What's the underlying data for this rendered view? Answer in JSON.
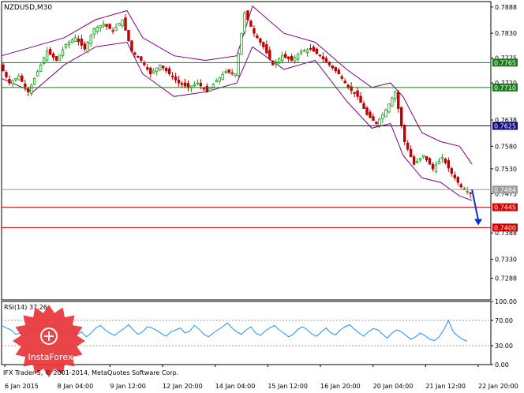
{
  "chart_data": [
    {
      "type": "candlestick",
      "title": "NZDUSD,M30",
      "ylim": [
        0.724,
        0.79
      ],
      "y_tick_labels": [
        "0.7888",
        "0.7830",
        "0.7775",
        "0.7720",
        "0.7638",
        "0.7580",
        "0.7530",
        "0.7475",
        "0.7388",
        "0.7330",
        "0.7288"
      ],
      "y_tick_values": [
        0.7888,
        0.783,
        0.7775,
        0.772,
        0.7638,
        0.758,
        0.753,
        0.7475,
        0.7388,
        0.733,
        0.7288
      ],
      "x_tick_labels": [
        "6 Jan 2015",
        "8 Jan 04:00",
        "9 Jan 12:00",
        "12 Jan 20:00",
        "14 Jan 04:00",
        "15 Jan 12:00",
        "16 Jan 20:00",
        "20 Jan 04:00",
        "21 Jan 12:00",
        "22 Jan 20:00"
      ],
      "close_path": [
        [
          0,
          0.776
        ],
        [
          3,
          0.772
        ],
        [
          6,
          0.7735
        ],
        [
          9,
          0.77
        ],
        [
          12,
          0.7745
        ],
        [
          15,
          0.779
        ],
        [
          18,
          0.777
        ],
        [
          21,
          0.7805
        ],
        [
          24,
          0.782
        ],
        [
          27,
          0.7795
        ],
        [
          30,
          0.784
        ],
        [
          33,
          0.785
        ],
        [
          36,
          0.7835
        ],
        [
          39,
          0.786
        ],
        [
          42,
          0.779
        ],
        [
          45,
          0.777
        ],
        [
          48,
          0.774
        ],
        [
          51,
          0.776
        ],
        [
          54,
          0.774
        ],
        [
          57,
          0.772
        ],
        [
          60,
          0.771
        ],
        [
          63,
          0.772
        ],
        [
          66,
          0.77
        ],
        [
          69,
          0.7725
        ],
        [
          72,
          0.7745
        ],
        [
          75,
          0.774
        ],
        [
          78,
          0.7875
        ],
        [
          81,
          0.783
        ],
        [
          84,
          0.78
        ],
        [
          87,
          0.776
        ],
        [
          90,
          0.778
        ],
        [
          93,
          0.777
        ],
        [
          96,
          0.779
        ],
        [
          99,
          0.7795
        ],
        [
          102,
          0.778
        ],
        [
          105,
          0.776
        ],
        [
          108,
          0.774
        ],
        [
          111,
          0.771
        ],
        [
          114,
          0.769
        ],
        [
          117,
          0.765
        ],
        [
          120,
          0.763
        ],
        [
          123,
          0.766
        ],
        [
          126,
          0.77
        ],
        [
          129,
          0.759
        ],
        [
          132,
          0.754
        ],
        [
          135,
          0.756
        ],
        [
          138,
          0.753
        ],
        [
          141,
          0.7555
        ],
        [
          144,
          0.752
        ],
        [
          147,
          0.749
        ],
        [
          150,
          0.7475
        ]
      ],
      "bands": [
        {
          "name": "upper",
          "values": [
            [
              0,
              0.778
            ],
            [
              10,
              0.78
            ],
            [
              20,
              0.782
            ],
            [
              30,
              0.786
            ],
            [
              40,
              0.788
            ],
            [
              45,
              0.782
            ],
            [
              55,
              0.778
            ],
            [
              65,
              0.777
            ],
            [
              75,
              0.778
            ],
            [
              80,
              0.789
            ],
            [
              90,
              0.783
            ],
            [
              100,
              0.781
            ],
            [
              110,
              0.775
            ],
            [
              118,
              0.771
            ],
            [
              124,
              0.772
            ],
            [
              128,
              0.769
            ],
            [
              134,
              0.761
            ],
            [
              140,
              0.759
            ],
            [
              146,
              0.758
            ],
            [
              150,
              0.754
            ]
          ]
        },
        {
          "name": "lower",
          "values": [
            [
              0,
              0.773
            ],
            [
              10,
              0.77
            ],
            [
              20,
              0.776
            ],
            [
              30,
              0.78
            ],
            [
              40,
              0.781
            ],
            [
              45,
              0.774
            ],
            [
              55,
              0.769
            ],
            [
              65,
              0.77
            ],
            [
              75,
              0.772
            ],
            [
              80,
              0.78
            ],
            [
              90,
              0.775
            ],
            [
              100,
              0.777
            ],
            [
              110,
              0.768
            ],
            [
              118,
              0.762
            ],
            [
              124,
              0.763
            ],
            [
              128,
              0.756
            ],
            [
              134,
              0.751
            ],
            [
              140,
              0.75
            ],
            [
              146,
              0.747
            ],
            [
              150,
              0.746
            ]
          ]
        }
      ],
      "horizontal_levels": [
        {
          "label": "0.7765",
          "value": 0.7765,
          "color": "#1a7a1a",
          "label_bg": "#1a7a1a"
        },
        {
          "label": "0.7710",
          "value": 0.771,
          "color": "#1a7a1a",
          "label_bg": "#1a7a1a"
        },
        {
          "label": "0.7625",
          "value": 0.7625,
          "color": "#0b0b80",
          "label_bg": "#0b0b80"
        },
        {
          "label": "0.7484",
          "value": 0.7484,
          "color": "#9a9a9a",
          "label_bg": "#9a9a9a"
        },
        {
          "label": "0.7445",
          "value": 0.7445,
          "color": "#d00000",
          "label_bg": "#d00000"
        },
        {
          "label": "0.7400",
          "value": 0.74,
          "color": "#d00000",
          "label_bg": "#d00000"
        }
      ],
      "arrow": {
        "from": [
          150,
          0.7484
        ],
        "to": [
          152,
          0.7405
        ],
        "color": "#1030d0"
      },
      "up_color": "#1a9a1a",
      "down_color": "#c00000",
      "band_color": "#800080"
    },
    {
      "type": "line",
      "title": "RSI(14) 37.26",
      "ylim": [
        0,
        100
      ],
      "y_tick_labels": [
        "100.00",
        "70.00",
        "30.00",
        "0.00"
      ],
      "y_tick_values": [
        100,
        70,
        30,
        0
      ],
      "levels": [
        70,
        30
      ],
      "series": [
        {
          "color": "#1e90ff",
          "values": [
            62,
            58,
            55,
            48,
            50,
            45,
            60,
            52,
            57,
            49,
            55,
            62,
            58,
            50,
            53,
            60,
            47,
            52,
            44,
            50,
            58,
            62,
            55,
            50,
            46,
            52,
            57,
            63,
            55,
            48,
            52,
            60,
            58,
            54,
            49,
            45,
            52,
            55,
            58,
            50,
            53,
            62,
            56,
            48,
            44,
            50,
            55,
            60,
            66,
            58,
            52,
            48,
            55,
            60,
            50,
            46,
            53,
            58,
            62,
            55,
            50,
            44,
            48,
            56,
            60,
            55,
            48,
            45,
            52,
            58,
            50,
            47,
            55,
            60,
            63,
            56,
            50,
            45,
            52,
            57,
            55,
            48,
            42,
            50,
            55,
            52,
            46,
            40,
            44,
            50,
            46,
            40,
            38,
            44,
            55,
            70,
            52,
            45,
            40,
            37
          ]
        }
      ]
    }
  ],
  "main_title": "NZDUSD,M30",
  "rsi_title": "RSI(14) 37.26",
  "copyright": "IFX Trader 5, © 2001-2014, MetaQuotes Software Corp.",
  "logo_text": "InstaForex",
  "colors": {
    "background": "#ffffff",
    "axis": "#000000",
    "grid_dot": "#c0c0c0"
  }
}
